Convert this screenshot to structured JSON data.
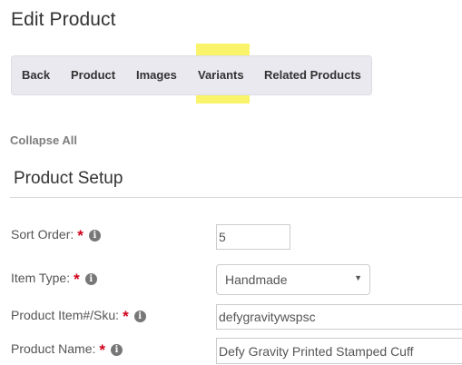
{
  "page": {
    "title": "Edit Product"
  },
  "tabs": [
    {
      "label": "Back"
    },
    {
      "label": "Product"
    },
    {
      "label": "Images"
    },
    {
      "label": "Variants",
      "highlighted": true
    },
    {
      "label": "Related Products"
    }
  ],
  "collapse_all_label": "Collapse All",
  "section": {
    "title": "Product Setup"
  },
  "required_marker": "*",
  "info_glyph": "i",
  "fields": {
    "sort_order": {
      "label": "Sort Order:",
      "value": "5"
    },
    "item_type": {
      "label": "Item Type:",
      "value": "Handmade"
    },
    "sku": {
      "label": "Product Item#/Sku:",
      "value": "defygravitywspsc"
    },
    "name": {
      "label": "Product Name:",
      "value": "Defy Gravity Printed Stamped Cuff"
    }
  },
  "colors": {
    "highlight": "#f8f35a",
    "required": "#d0021b",
    "tabbar_bg": "#e9e9ef"
  }
}
